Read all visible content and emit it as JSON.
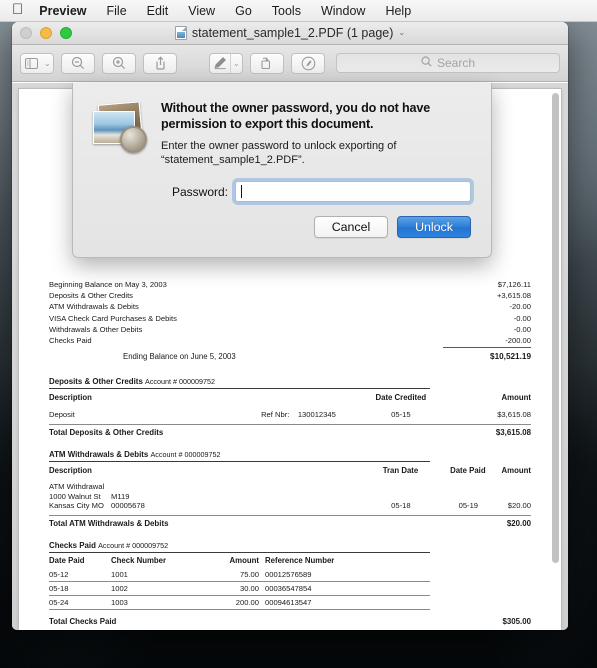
{
  "menubar": {
    "apple_glyph": "",
    "items": [
      {
        "label": "Preview",
        "bold": true
      },
      {
        "label": "File"
      },
      {
        "label": "Edit"
      },
      {
        "label": "View"
      },
      {
        "label": "Go"
      },
      {
        "label": "Tools"
      },
      {
        "label": "Window"
      },
      {
        "label": "Help"
      }
    ]
  },
  "window": {
    "title": "statement_sample1_2.PDF (1 page)",
    "title_chevron": "⌄"
  },
  "toolbar": {
    "sidebar_chevron": "⌄",
    "markup_chevron": "⌄",
    "search_placeholder": "Search"
  },
  "dialog": {
    "title": "Without the owner password, you do not have permission to export this document.",
    "message": "Enter the owner password to unlock exporting of “statement_sample1_2.PDF”.",
    "password_label": "Password:",
    "password_value": "",
    "cancel_label": "Cancel",
    "unlock_label": "Unlock",
    "accent_color": "#2f7fd8"
  },
  "document": {
    "summary": {
      "rows": [
        {
          "label": "Beginning Balance on May 3, 2003",
          "amount": "$7,126.11"
        },
        {
          "label": "Deposits & Other Credits",
          "amount": "+3,615.08"
        },
        {
          "label": "ATM Withdrawals & Debits",
          "amount": "-20.00"
        },
        {
          "label": "VISA Check Card Purchases & Debits",
          "amount": "-0.00"
        },
        {
          "label": "Withdrawals & Other Debits",
          "amount": "-0.00"
        },
        {
          "label": "Checks Paid",
          "amount": "-200.00"
        }
      ],
      "ending_label": "Ending Balance on June 5, 2003",
      "ending_amount": "$10,521.19"
    },
    "deposits": {
      "heading": "Deposits & Other Credits",
      "account": "Account # 000009752",
      "columns": {
        "description": "Description",
        "date": "Date Credited",
        "amount": "Amount"
      },
      "rows": [
        {
          "description": "Deposit",
          "ref_label": "Ref Nbr:",
          "ref_number": "130012345",
          "date": "05-15",
          "amount": "$3,615.08"
        }
      ],
      "total_label": "Total Deposits & Other Credits",
      "total_amount": "$3,615.08"
    },
    "atm": {
      "heading": "ATM Withdrawals & Debits",
      "account": "Account # 000009752",
      "columns": {
        "description": "Description",
        "tran_date": "Tran Date",
        "date_paid": "Date Paid",
        "amount": "Amount"
      },
      "rows": [
        {
          "line1": "ATM Withdrawal",
          "line2_a": "1000 Walnut St",
          "line2_b": "M119",
          "line3_a": "Kansas City MO",
          "line3_b": "00005678",
          "tran_date": "05-18",
          "date_paid": "05-19",
          "amount": "$20.00"
        }
      ],
      "total_label": "Total ATM Withdrawals & Debits",
      "total_amount": "$20.00"
    },
    "checks": {
      "heading": "Checks Paid",
      "account": "Account # 000009752",
      "columns": [
        "Date Paid",
        "Check Number",
        "Amount",
        "Reference Number"
      ],
      "rows": [
        {
          "date_paid": "05-12",
          "check_number": "1001",
          "amount": "75.00",
          "reference": "00012576589"
        },
        {
          "date_paid": "05-18",
          "check_number": "1002",
          "amount": "30.00",
          "reference": "00036547854"
        },
        {
          "date_paid": "05-24",
          "check_number": "1003",
          "amount": "200.00",
          "reference": "00094613547"
        }
      ],
      "total_label": "Total Checks Paid",
      "total_amount": "$305.00"
    }
  }
}
